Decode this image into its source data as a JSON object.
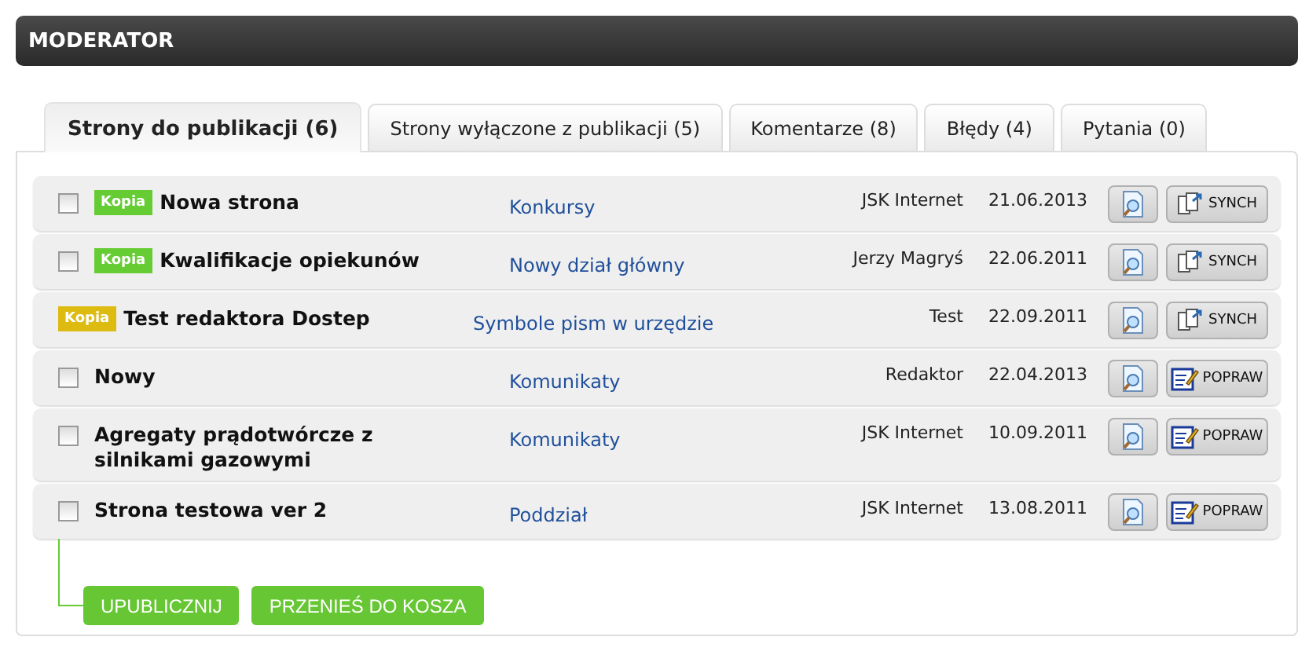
{
  "header": {
    "title": "MODERATOR"
  },
  "tabs": [
    {
      "label": "Strony do publikacji (6)",
      "selected": true
    },
    {
      "label": "Strony wyłączone z publikacji (5)",
      "selected": false
    },
    {
      "label": "Komentarze (8)",
      "selected": false
    },
    {
      "label": "Błędy (4)",
      "selected": false
    },
    {
      "label": "Pytania (0)",
      "selected": false
    }
  ],
  "rows": [
    {
      "checked": false,
      "badge": {
        "text": "Kopia",
        "color": "#66cc33"
      },
      "title": "Nowa strona",
      "category": "Konkursy",
      "author": "JSK Internet",
      "date": "21.06.2013",
      "action": {
        "kind": "synch",
        "label": "SYNCH"
      }
    },
    {
      "checked": false,
      "badge": {
        "text": "Kopia",
        "color": "#66cc33"
      },
      "title": "Kwalifikacje opiekunów",
      "category": "Nowy dział główny",
      "author": "Jerzy Magryś",
      "date": "22.06.2011",
      "action": {
        "kind": "synch",
        "label": "SYNCH"
      }
    },
    {
      "badge": {
        "text": "Kopia",
        "color": "#ddbb11"
      },
      "title": "Test redaktora Dostep",
      "category": "Symbole pism w urzędzie",
      "author": "Test",
      "date": "22.09.2011",
      "action": {
        "kind": "synch",
        "label": "SYNCH"
      }
    },
    {
      "checked": false,
      "title": "Nowy",
      "category": "Komunikaty",
      "author": "Redaktor",
      "date": "22.04.2013",
      "action": {
        "kind": "popraw",
        "label": "POPRAW"
      }
    },
    {
      "checked": false,
      "title": "Agregaty prądotwórcze z silnikami gazowymi",
      "category": "Komunikaty",
      "author": "JSK Internet",
      "date": "10.09.2011",
      "action": {
        "kind": "popraw",
        "label": "POPRAW"
      }
    },
    {
      "checked": false,
      "title": "Strona testowa ver 2",
      "category": "Poddział",
      "author": "JSK Internet",
      "date": "13.08.2011",
      "action": {
        "kind": "popraw",
        "label": "POPRAW"
      }
    }
  ],
  "bulk_actions": [
    "UPUBLICZNIJ",
    "PRZENIEŚ DO KOSZA"
  ]
}
